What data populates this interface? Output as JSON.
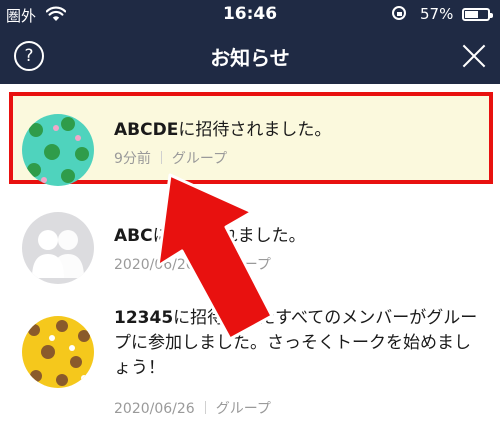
{
  "status_bar": {
    "carrier": "圏外",
    "time": "16:46",
    "battery_percent": "57%",
    "battery_level": 0.57
  },
  "header": {
    "title": "お知らせ",
    "help_label": "?"
  },
  "notifications": [
    {
      "bold": "ABCDE",
      "text": "に招待されました。",
      "time": "9分前",
      "category": "グループ",
      "highlighted": true
    },
    {
      "bold": "ABC",
      "text": "に招待されました。",
      "time": "2020/06/26",
      "category": "グループ",
      "highlighted": false
    },
    {
      "bold": "12345",
      "text": "に招待されたすべてのメンバーがグループに参加しました。さっそくトークを始めましょう！",
      "time": "2020/06/26",
      "category": "グループ",
      "highlighted": false
    }
  ],
  "colors": {
    "nav_bg": "#1f2a44",
    "highlight_border": "#e8110f",
    "highlight_bg": "#fbf9dd",
    "arrow": "#e8110f"
  },
  "icons": [
    "wifi-icon",
    "rotation-lock-icon",
    "battery-icon",
    "help-icon",
    "close-icon",
    "pointer-arrow"
  ]
}
